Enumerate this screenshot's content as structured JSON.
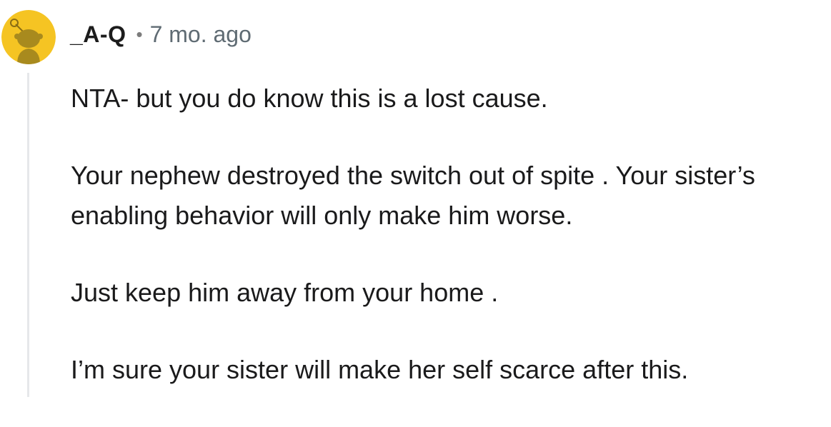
{
  "comment": {
    "username": "_A-Q",
    "separator": "•",
    "timestamp": "7 mo. ago",
    "avatar_color": "#F5C423",
    "paragraphs": [
      "NTA- but you do know this is a lost cause.",
      "Your nephew destroyed the switch out of spite . Your sister’s enabling behavior will only make him worse.",
      "Just keep him away from your home .",
      "I’m sure your sister will make her self scarce after this."
    ]
  }
}
